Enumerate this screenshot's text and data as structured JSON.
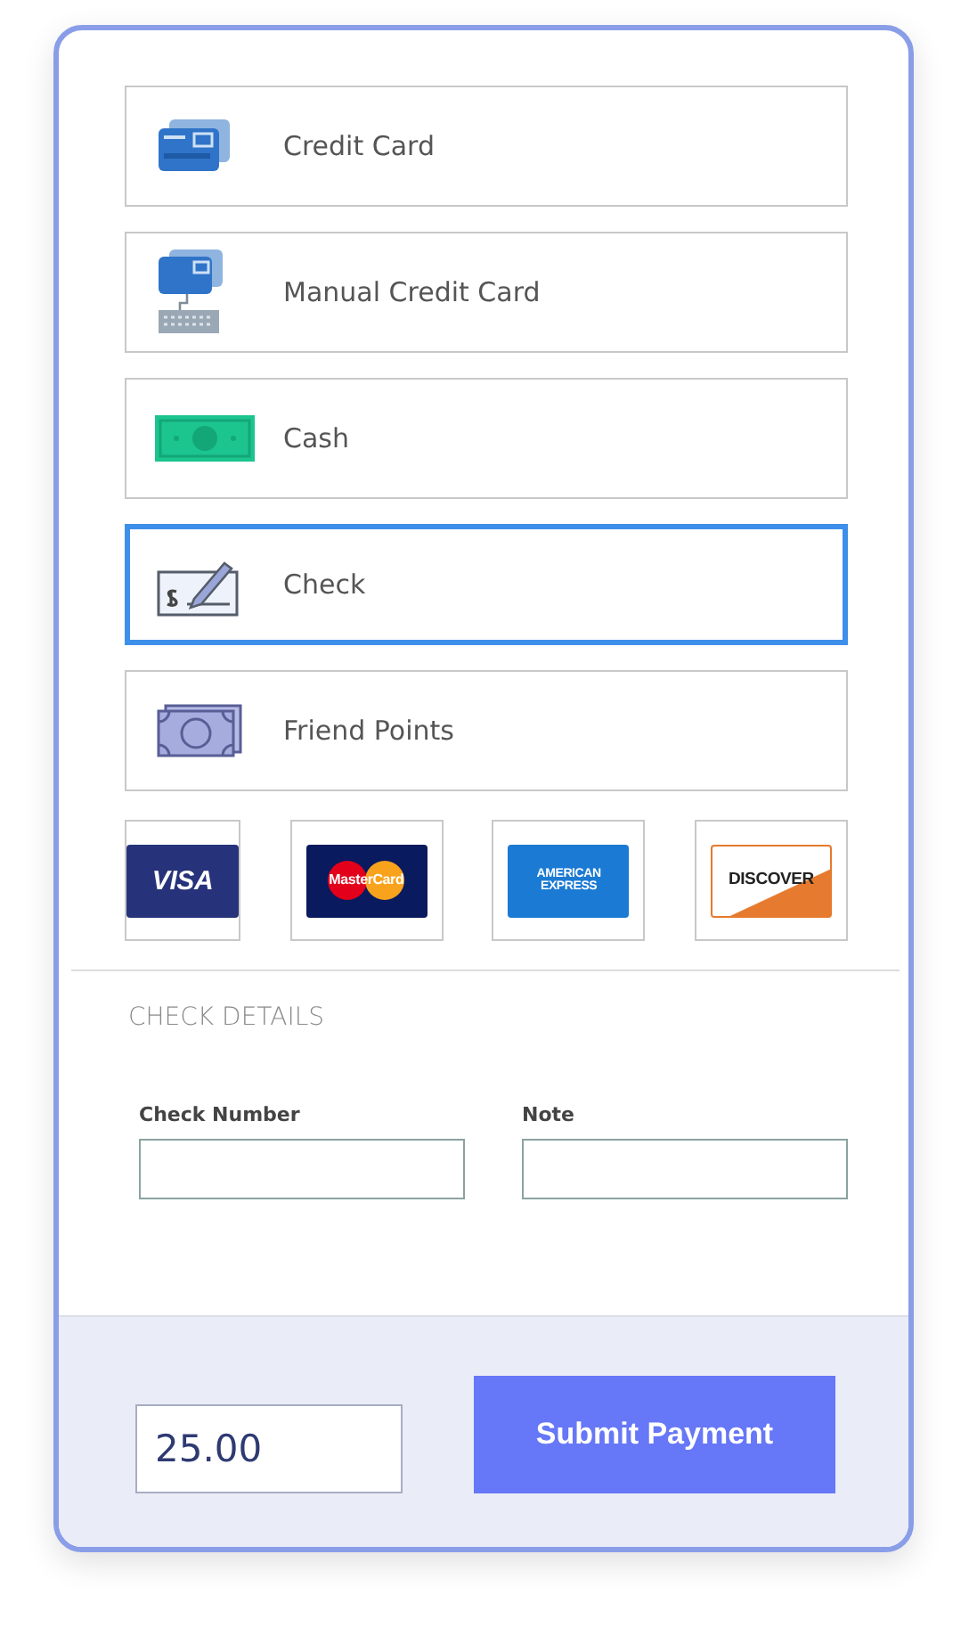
{
  "payment_methods": [
    {
      "kind": "card",
      "label": "Credit Card",
      "selected": false
    },
    {
      "kind": "manual",
      "label": "Manual Credit Card",
      "selected": false
    },
    {
      "kind": "cash",
      "label": "Cash",
      "selected": false
    },
    {
      "kind": "check",
      "label": "Check",
      "selected": true
    },
    {
      "kind": "points",
      "label": "Friend Points",
      "selected": false
    }
  ],
  "card_brands": [
    {
      "kind": "visa",
      "label": "VISA"
    },
    {
      "kind": "mastercard",
      "label": "MasterCard"
    },
    {
      "kind": "amex",
      "label": "AMERICAN EXPRESS"
    },
    {
      "kind": "discover",
      "label": "DISCOVER"
    }
  ],
  "details": {
    "title": "CHECK DETAILS",
    "fields": [
      {
        "label": "Check Number"
      },
      {
        "label": "Note"
      }
    ]
  },
  "footer": {
    "amount": "25.00",
    "submit": "Submit Payment"
  }
}
